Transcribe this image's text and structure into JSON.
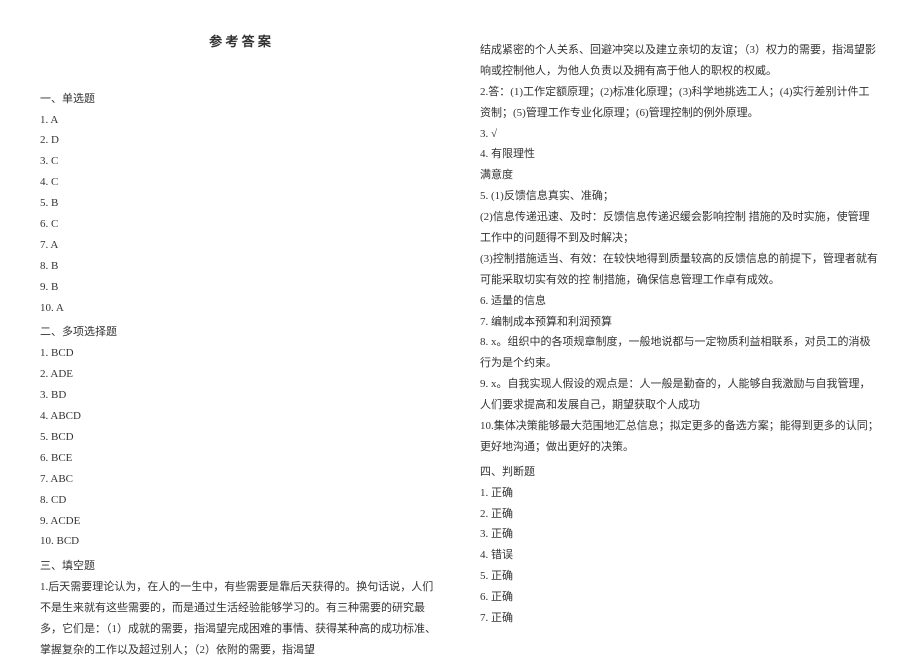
{
  "title": "参 考 答 案",
  "col1": {
    "section1_heading": "一、单选题",
    "single": [
      "1. A",
      "2. D",
      "3. C",
      "4. C",
      "5. B",
      "6. C",
      "7. A",
      "8. B",
      "9. B",
      "10. A"
    ],
    "section2_heading": "二、多项选择题",
    "multi": [
      "1. BCD",
      "2. ADE",
      "3. BD",
      "4. ABCD",
      "5. BCD",
      "6. BCE",
      "7. ABC",
      "8. CD",
      "9. ACDE",
      "10. BCD"
    ],
    "section3_heading": "三、填空题",
    "fill_para": "1.后天需要理论认为，在人的一生中，有些需要是靠后天获得的。换句话说，人们不是生来就有这些需要的，而是通过生活经验能够学习的。有三种需要的研究最多，它们是：（1）成就的需要，指渴望完成困难的事情、获得某种高的成功标准、掌握复杂的工作以及超过别人；（2）依附的需要，指渴望"
  },
  "col2": {
    "cont1": "结成紧密的个人关系、回避冲突以及建立亲切的友谊；（3）权力的需要，指渴望影响或控制他人，为他人负责以及拥有高于他人的职权的权威。",
    "q2": "2.答：(1)工作定额原理；(2)标准化原理；(3)科学地挑选工人；(4)实行差别计件工资制；(5)管理工作专业化原理；(6)管理控制的例外原理。",
    "q3": "3. √",
    "q4a": "4. 有限理性",
    "q4b": "满意度",
    "q5a": "5. (1)反馈信息真实、准确；",
    "q5b": "(2)信息传递迅速、及时：反馈信息传递迟缓会影响控制 措施的及时实施，使管理工作中的问题得不到及时解决；",
    "q5c": "(3)控制措施适当、有效：在较快地得到质量较高的反馈信息的前提下，管理者就有可能采取切实有效的控 制措施，确保信息管理工作卓有成效。",
    "q6": "6. 适量的信息",
    "q7": "7. 编制成本预算和利润预算",
    "q8": "8. x。组织中的各项规章制度，一般地说都与一定物质利益相联系，对员工的消极行为是个约束。",
    "q9": "9. x。自我实现人假设的观点是：人一般是勤奋的，人能够自我激励与自我管理，人们要求提高和发展自己，期望获取个人成功",
    "q10": "10.集体决策能够最大范围地汇总信息；拟定更多的备选方案；能得到更多的认同；更好地沟通；做出更好的决策。",
    "section4_heading": "四、判断题",
    "judge": [
      "1. 正确",
      "2. 正确",
      "3. 正确",
      "4. 错误",
      "5. 正确",
      "6. 正确",
      "7. 正确"
    ]
  }
}
